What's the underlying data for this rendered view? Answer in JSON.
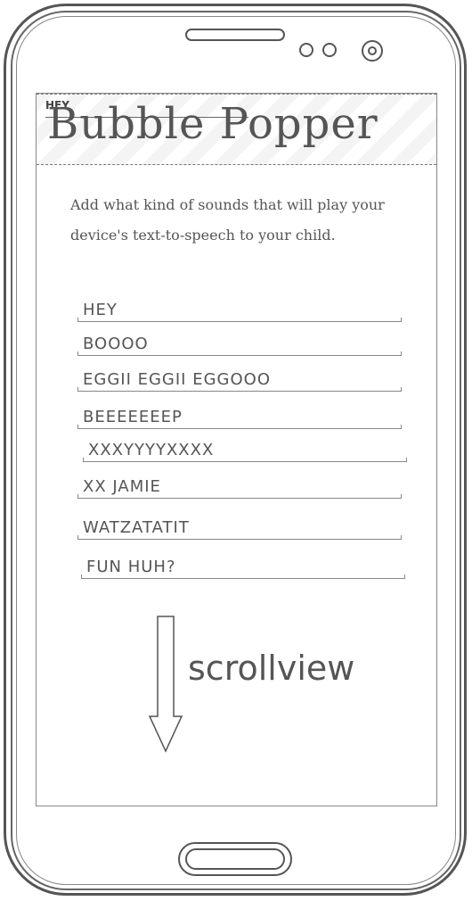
{
  "app": {
    "title": "Bubble Popper",
    "header_tag": "HEY"
  },
  "description": "Add what kind of sounds that will play your device's text-to-speech to your child.",
  "sounds": [
    "HEY",
    "BOOOO",
    "EGGII EGGII EGGOOO",
    "BEEEEEEEP",
    "XXXYYYYXXXX",
    "XX JAMIE",
    "WATZATATIT",
    "FUN HUH?"
  ],
  "scroll_hint": "scrollview",
  "icons": {
    "arrow": "arrow-down-icon",
    "camera": "camera-icon"
  }
}
